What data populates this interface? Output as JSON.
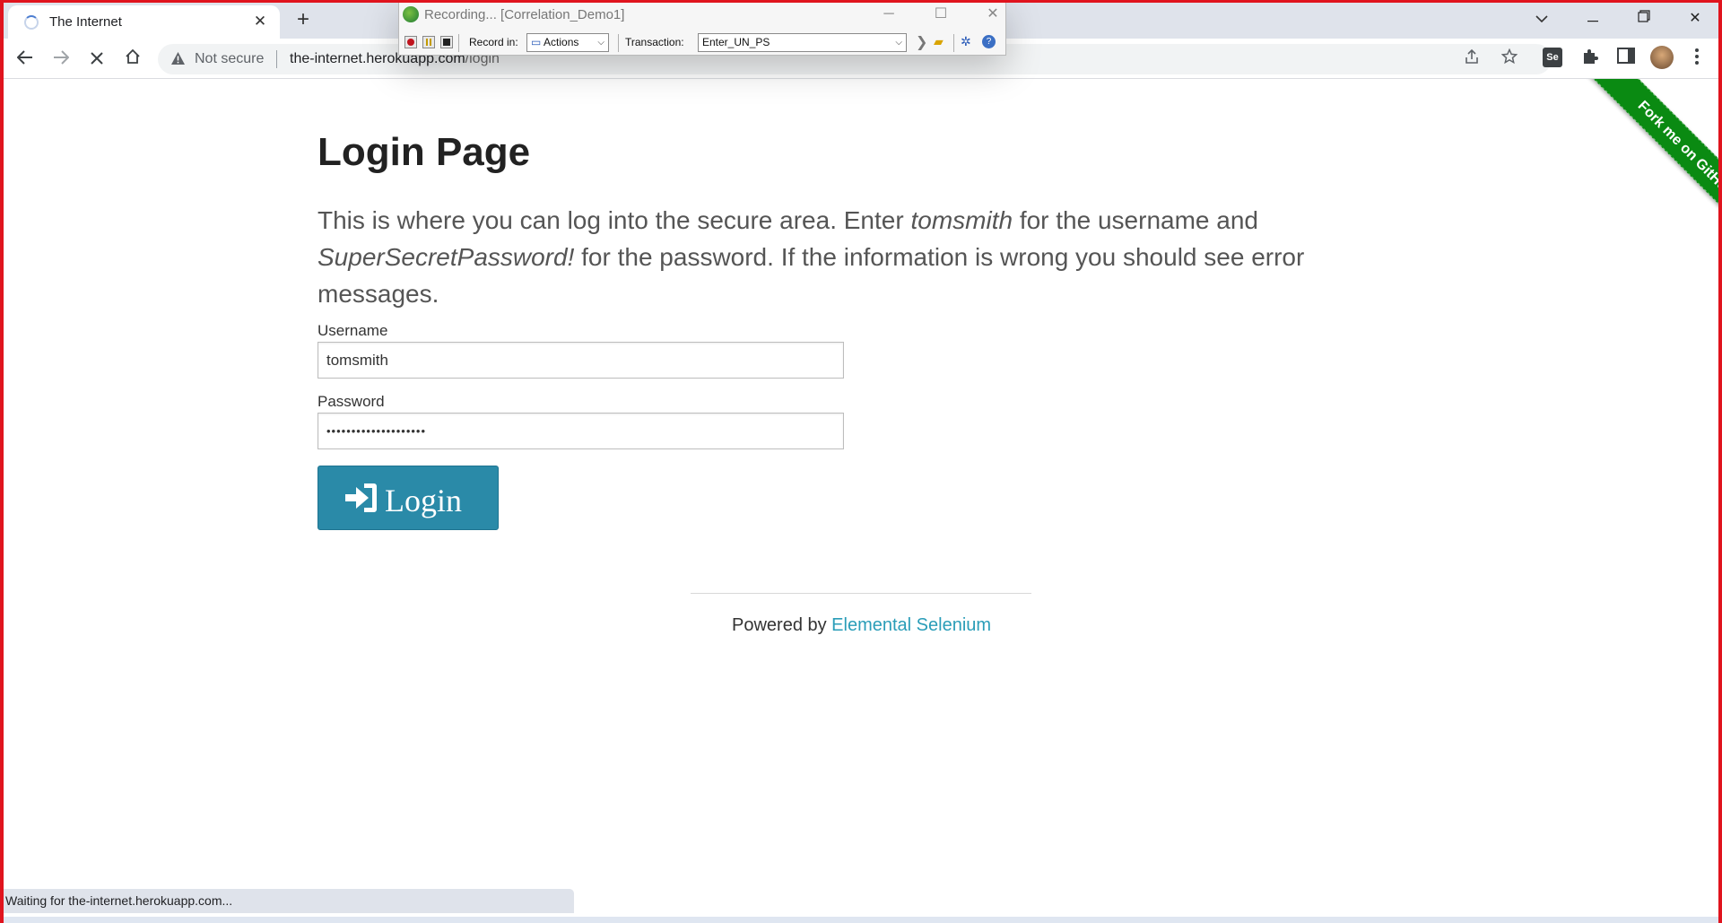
{
  "browser": {
    "tab_title": "The Internet",
    "url_host": "the-internet.herokuapp.com",
    "url_path": "/login",
    "security_label": "Not secure",
    "status_text": "Waiting for the-internet.herokuapp.com..."
  },
  "recorder": {
    "title": "Recording... [Correlation_Demo1]",
    "record_in_label": "Record in:",
    "record_in_value": "Actions",
    "transaction_label": "Transaction:",
    "transaction_value": "Enter_UN_PS"
  },
  "page": {
    "heading": "Login Page",
    "intro_part1": "This is where you can log into the secure area. Enter ",
    "intro_user": "tomsmith",
    "intro_part2": " for the username and ",
    "intro_pass": "SuperSecretPassword!",
    "intro_part3": " for the password. If the information is wrong you should see error messages.",
    "username_label": "Username",
    "username_value": "tomsmith",
    "password_label": "Password",
    "password_value": "••••••••••••••••••••",
    "login_button": "Login",
    "powered_by": "Powered by ",
    "powered_link": "Elemental Selenium",
    "ribbon": "Fork me on GitHub"
  }
}
